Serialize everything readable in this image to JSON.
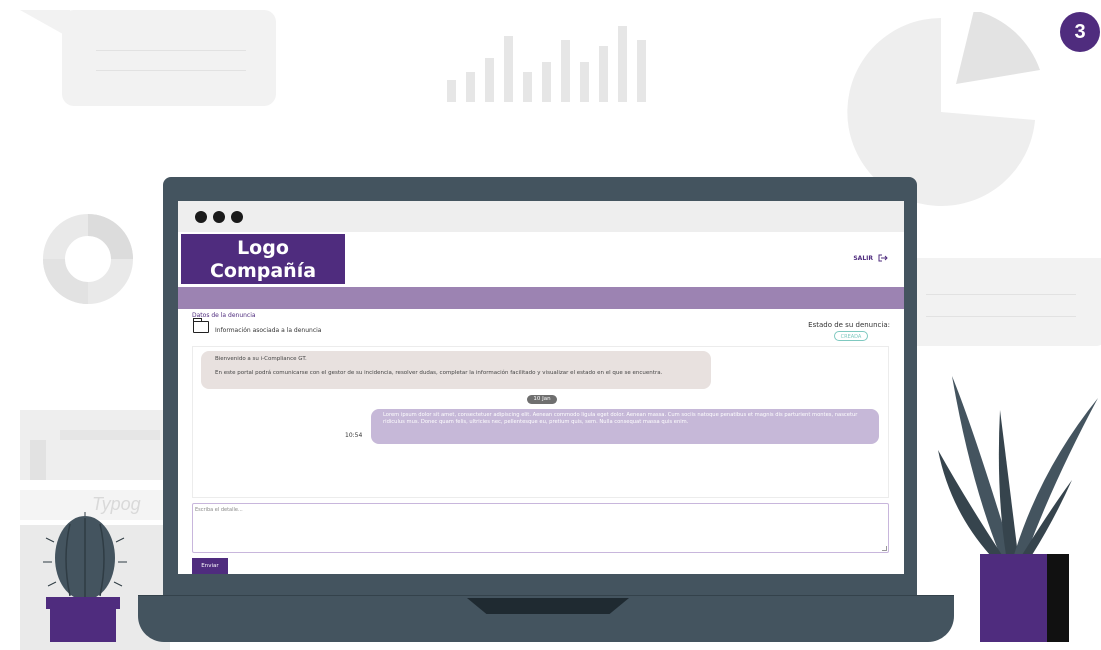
{
  "step_badge": "3",
  "background": {
    "typo_text": "Typog"
  },
  "browser": {
    "window_dots": [
      "dot",
      "dot",
      "dot"
    ]
  },
  "app": {
    "logo_line1": "Logo",
    "logo_line2": "Compañía",
    "logout_label": "SALIR",
    "logout_icon": "logout-icon",
    "section_title": "Datos de la denuncia",
    "info_label": "Información asociada a la denuncia",
    "status_label": "Estado de su denuncia:",
    "status_value": "CREADA",
    "colors": {
      "brand": "#4f2c7e",
      "band": "#9c83b2",
      "status": "#7fc9c0",
      "incoming_bubble": "#e8e1df",
      "outgoing_bubble": "#c6b8d8"
    }
  },
  "chat": {
    "welcome_line1": "Bienvenido a su i-Compliance GT.",
    "welcome_line2": "En este portal podrá comunicarse con el gestor de su incidencia, resolver dudas, completar la información facilitado y visualizar el estado en el que se encuentra.",
    "date_separator": "10 Jan",
    "message_time": "10:54",
    "message_text": "Lorem ipsum dolor sit amet, consectetuer adipiscing elit. Aenean commodo ligula eget dolor. Aenean massa. Cum sociis natoque penatibus et magnis dis parturient montes, nascetur ridiculus mus. Donec quam felis, ultricies nec, pellentesque eu, pretium quis, sem. Nulla consequat massa quis enim."
  },
  "composer": {
    "placeholder": "Escriba el detalle...",
    "send_label": "Enviar"
  }
}
